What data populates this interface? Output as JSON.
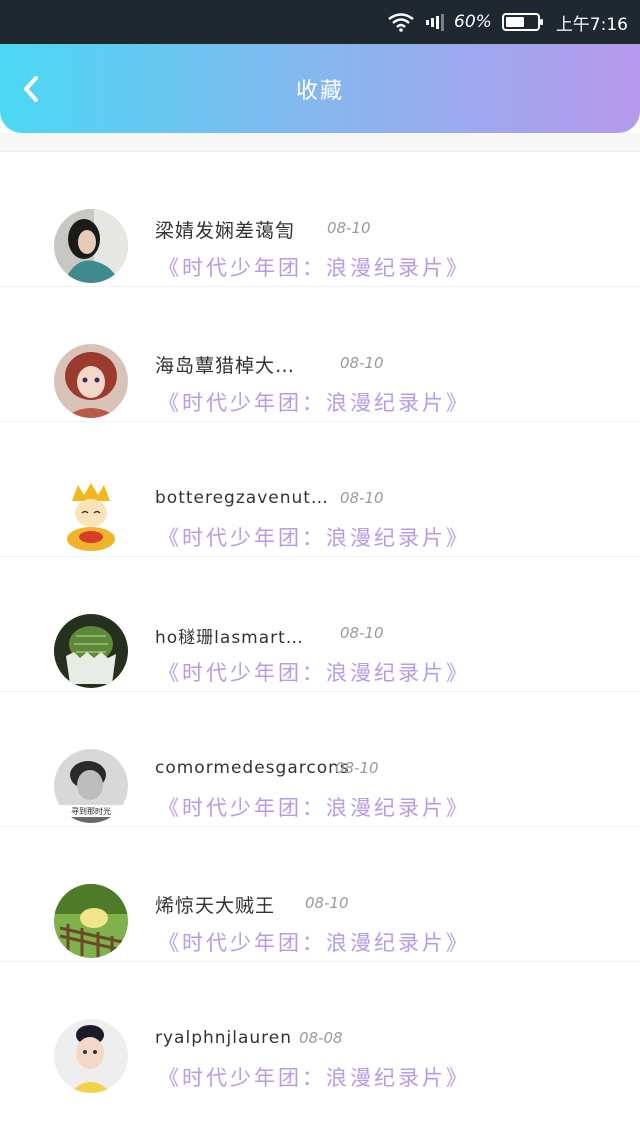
{
  "status_bar": {
    "battery_percent": "60%",
    "time": "上午7:16",
    "battery_level": 0.6
  },
  "header": {
    "title": "收藏"
  },
  "favorites": [
    {
      "user": "梁婧发娴差蔼訇",
      "date": "08-10",
      "title": "《时代少年团：浪漫纪录片》"
    },
    {
      "user": "海岛蕈猎棹大…",
      "date": "08-10",
      "title": "《时代少年团：浪漫纪录片》"
    },
    {
      "user": "botteregzavenut…",
      "date": "08-10",
      "title": "《时代少年团：浪漫纪录片》"
    },
    {
      "user": "ho穟珊lasmart…",
      "date": "08-10",
      "title": "《时代少年团：浪漫纪录片》"
    },
    {
      "user": "comormedesgarcons",
      "date": "08-10",
      "title": "《时代少年团：浪漫纪录片》"
    },
    {
      "user": "烯惊天大贼王",
      "date": "08-10",
      "title": "《时代少年团：浪漫纪录片》"
    },
    {
      "user": "ryalphnjlauren",
      "date": "08-08",
      "title": "《时代少年团：浪漫纪录片》"
    }
  ],
  "avatar_caption": "寻到那时光",
  "colors": {
    "header_gradient_start": "#4ad8f2",
    "header_gradient_end": "#b699ec",
    "title_color": "#b79be6",
    "status_bar_bg": "#1f2730"
  }
}
